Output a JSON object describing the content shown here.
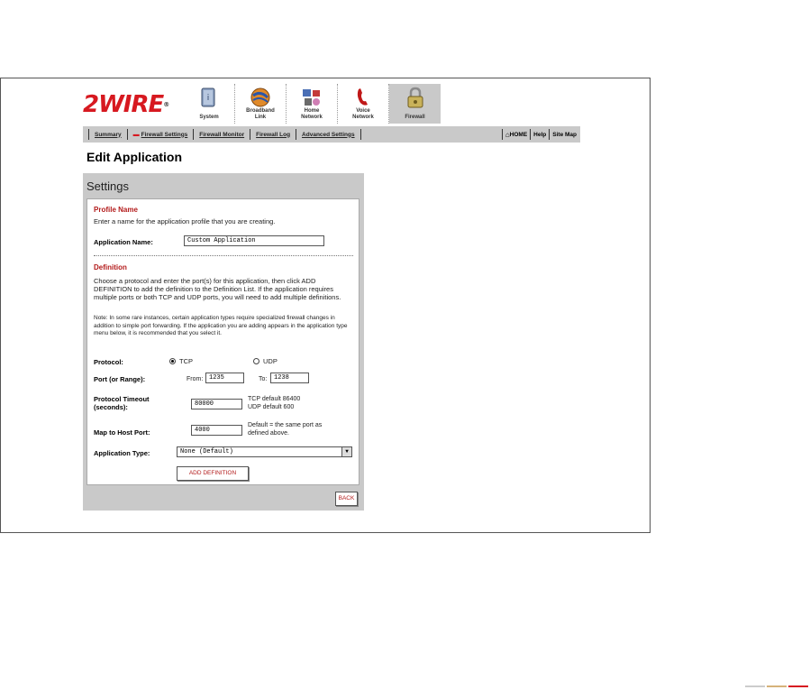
{
  "brand": {
    "logo_text": "2WIRE",
    "logo_mark": "®",
    "accent": "#d71920"
  },
  "top_nav": [
    {
      "label": "System",
      "icon": "system-icon",
      "active": false
    },
    {
      "label": "Broadband\nLink",
      "icon": "broadband-icon",
      "active": false
    },
    {
      "label": "Home\nNetwork",
      "icon": "home-network-icon",
      "active": false
    },
    {
      "label": "Voice\nNetwork",
      "icon": "voice-icon",
      "active": false
    },
    {
      "label": "Firewall",
      "icon": "lock-icon",
      "active": true
    }
  ],
  "sub_nav": {
    "items": [
      {
        "label": "Summary"
      },
      {
        "label": "Firewall Settings",
        "active": true
      },
      {
        "label": "Firewall Monitor"
      },
      {
        "label": "Firewall Log"
      },
      {
        "label": "Advanced Settings"
      }
    ],
    "home": "HOME",
    "help": "Help",
    "site_map": "Site Map"
  },
  "page_title": "Edit Application",
  "panel": {
    "title": "Settings",
    "profile": {
      "heading": "Profile Name",
      "intro": "Enter a name for the application profile that you are creating.",
      "app_name_label": "Application Name:",
      "app_name_value": "Custom Application"
    },
    "definition": {
      "heading": "Definition",
      "intro": "Choose a protocol and enter the port(s) for this application, then click ADD DEFINITION to add the definition to the Definition List. If the application requires multiple ports or both TCP and UDP ports, you will need to add multiple definitions.",
      "note": "Note: In some rare instances, certain application types require specialized firewall changes in addition to simple port forwarding. If the application you are adding appears in the application type menu below, it is recommended that you select it.",
      "protocol_label": "Protocol:",
      "tcp": "TCP",
      "udp": "UDP",
      "port_label": "Port (or Range):",
      "from": "From:",
      "from_value": "1235",
      "to": "To:",
      "to_value": "1238",
      "timeout_label": "Protocol Timeout (seconds):",
      "timeout_value": "80000",
      "tcp_default": "TCP default 86400",
      "udp_default": "UDP default 600",
      "map_label": "Map to Host Port:",
      "map_value": "4000",
      "map_hint": "Default = the same port as defined above.",
      "app_type_label": "Application Type:",
      "app_type_value": "None (Default)",
      "add_button": "ADD DEFINITION"
    },
    "back_button": "BACK"
  }
}
